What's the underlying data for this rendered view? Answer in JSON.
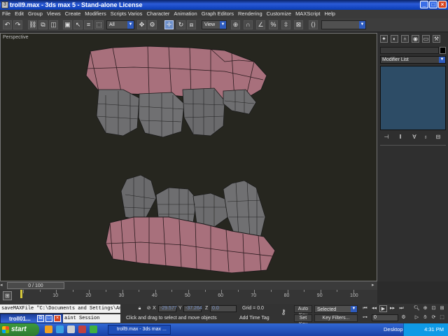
{
  "window": {
    "title": "troll9.max - 3ds max 5 - Stand-alone License",
    "minimize": "_",
    "maximize": "□",
    "close": "×"
  },
  "menu": [
    "File",
    "Edit",
    "Group",
    "Views",
    "Create",
    "Modifiers",
    "Scripts Varios",
    "Character",
    "Animation",
    "Graph Editors",
    "Rendering",
    "Customize",
    "MAXScript",
    "Help"
  ],
  "toolbar": {
    "selection_filter": "All",
    "ref_coord": "View",
    "named_selection": ""
  },
  "viewport": {
    "label": "Perspective",
    "colors": {
      "background": "#26261f",
      "gum": "#a8707c",
      "tooth": "#6e6e70",
      "wire": "#1a1a1a"
    }
  },
  "command_panel": {
    "tabs": [
      "create-icon",
      "modify-icon",
      "hierarchy-icon",
      "motion-icon",
      "display-icon",
      "utilities-icon"
    ],
    "object_name": "",
    "modifier_list": "Modifier List",
    "stack_buttons": [
      "pin-stack-icon",
      "show-end-result-icon",
      "make-unique-icon",
      "remove-modifier-icon",
      "configure-sets-icon"
    ]
  },
  "timeline": {
    "slider_label": "0 / 100",
    "ticks": [
      "10",
      "20",
      "30",
      "40",
      "50",
      "60",
      "70",
      "80",
      "90",
      "100"
    ],
    "current_frame": 0,
    "total_frames": 100
  },
  "status": {
    "maxscript_line1": "saveMAXFile \"C:\\Documents and Settings\\Andre",
    "maxscript_line2": "aint Session",
    "popup_title": "troll01...",
    "x_label": "X",
    "x_value": "-29.577",
    "y_label": "Y",
    "y_value": "-37.264",
    "z_label": "Z",
    "z_value": "0.0",
    "grid_label": "Grid = 0.0",
    "prompt": "Click and drag to select and move objects",
    "add_time_tag": "Add Time Tag",
    "auto_key": "Auto Key",
    "set_key": "Set Key",
    "selected": "Selected",
    "key_filters": "Key Filters...",
    "frame_field": "0"
  },
  "taskbar": {
    "start": "start",
    "app_button": "troll9.max - 3ds max ...",
    "desktop": "Desktop",
    "clock": "4:31 PM"
  }
}
